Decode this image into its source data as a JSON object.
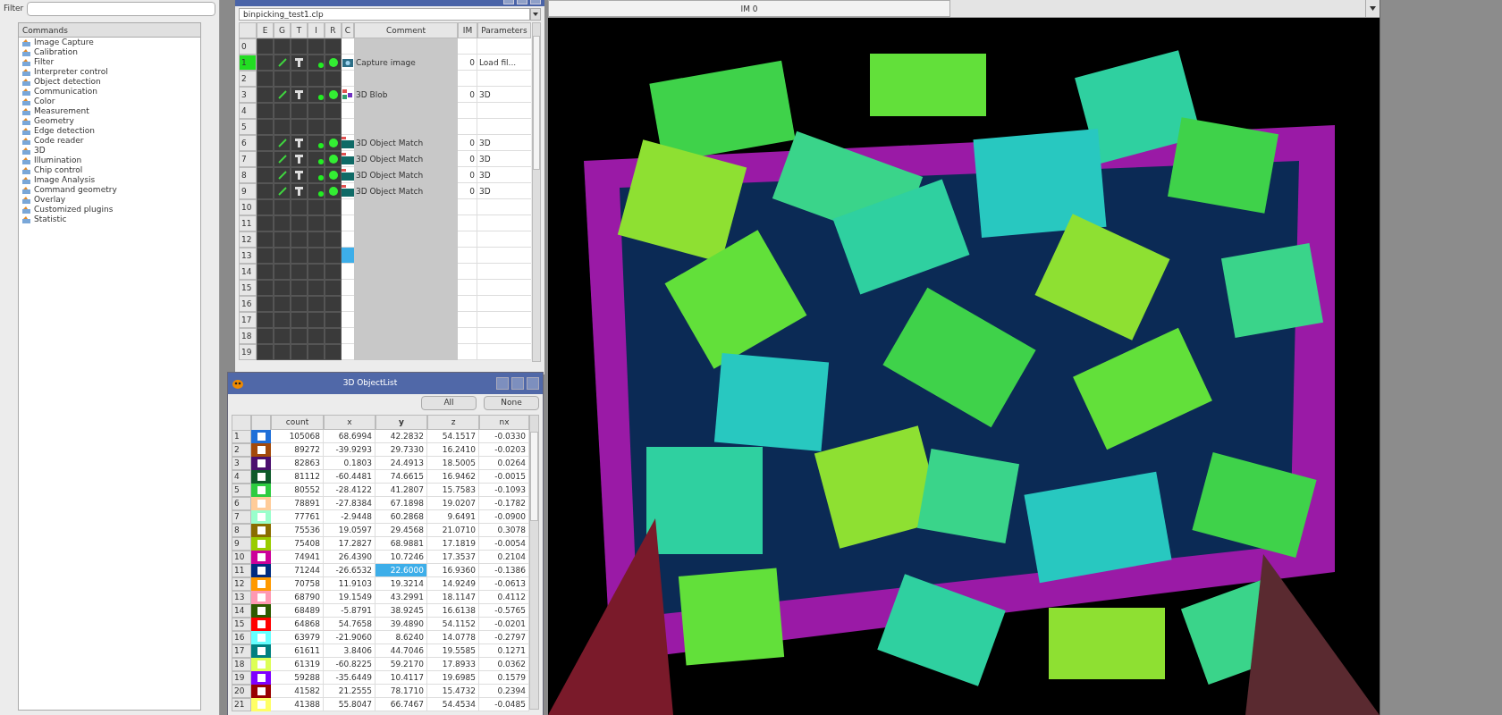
{
  "commands_panel": {
    "filter_label": "Filter",
    "header": "Commands",
    "items": [
      "Image Capture",
      "Calibration",
      "Filter",
      "Interpreter control",
      "Object detection",
      "Communication",
      "Color",
      "Measurement",
      "Geometry",
      "Edge detection",
      "Code reader",
      "3D",
      "Illumination",
      "Chip control",
      "Image Analysis",
      "Command geometry",
      "Overlay",
      "Customized plugins",
      "Statistic"
    ]
  },
  "program_window": {
    "file": "binpicking_test1.clp",
    "columns": [
      "E",
      "G",
      "T",
      "I",
      "R",
      "C",
      "Comment",
      "IM",
      "Parameters"
    ],
    "rows": [
      {
        "number": "0",
        "kind": "empty",
        "active": false,
        "selected": false
      },
      {
        "number": "1",
        "kind": "capture",
        "active": true,
        "selected": false,
        "comment": "Capture image",
        "im": "0",
        "parameters": "Load fil..."
      },
      {
        "number": "2",
        "kind": "empty",
        "active": false,
        "selected": false
      },
      {
        "number": "3",
        "kind": "blob",
        "active": false,
        "selected": false,
        "comment": "3D Blob",
        "im": "0",
        "parameters": "3D"
      },
      {
        "number": "4",
        "kind": "empty",
        "active": false,
        "selected": false
      },
      {
        "number": "5",
        "kind": "empty",
        "active": false,
        "selected": false
      },
      {
        "number": "6",
        "kind": "match",
        "active": false,
        "selected": false,
        "comment": "3D Object Match",
        "im": "0",
        "parameters": "3D"
      },
      {
        "number": "7",
        "kind": "match",
        "active": false,
        "selected": false,
        "comment": "3D Object Match",
        "im": "0",
        "parameters": "3D"
      },
      {
        "number": "8",
        "kind": "match",
        "active": false,
        "selected": false,
        "comment": "3D Object Match",
        "im": "0",
        "parameters": "3D"
      },
      {
        "number": "9",
        "kind": "match",
        "active": false,
        "selected": false,
        "comment": "3D Object Match",
        "im": "0",
        "parameters": "3D"
      },
      {
        "number": "10",
        "kind": "empty",
        "active": false,
        "selected": false
      },
      {
        "number": "11",
        "kind": "empty",
        "active": false,
        "selected": false
      },
      {
        "number": "12",
        "kind": "empty",
        "active": false,
        "selected": false
      },
      {
        "number": "13",
        "kind": "empty",
        "active": false,
        "selected": true
      },
      {
        "number": "14",
        "kind": "empty",
        "active": false,
        "selected": false
      },
      {
        "number": "15",
        "kind": "empty",
        "active": false,
        "selected": false
      },
      {
        "number": "16",
        "kind": "empty",
        "active": false,
        "selected": false
      },
      {
        "number": "17",
        "kind": "empty",
        "active": false,
        "selected": false
      },
      {
        "number": "18",
        "kind": "empty",
        "active": false,
        "selected": false
      },
      {
        "number": "19",
        "kind": "empty",
        "active": false,
        "selected": false
      }
    ]
  },
  "object_list": {
    "title": "3D ObjectList",
    "buttons": [
      "All",
      "None"
    ],
    "columns": [
      {
        "label": "count",
        "selected": false
      },
      {
        "label": "x",
        "selected": false
      },
      {
        "label": "y",
        "selected": true
      },
      {
        "label": "z",
        "selected": false
      },
      {
        "label": "nx",
        "selected": false
      }
    ],
    "rows": [
      {
        "number": "1",
        "color": "#1f6fd8",
        "selected": false,
        "values": [
          "105068",
          "68.6994",
          "42.2832",
          "54.1517",
          "-0.0330"
        ]
      },
      {
        "number": "2",
        "color": "#a34a0a",
        "selected": false,
        "values": [
          "89272",
          "-39.9293",
          "29.7330",
          "16.2410",
          "-0.0203"
        ]
      },
      {
        "number": "3",
        "color": "#4b0f6e",
        "selected": false,
        "values": [
          "82863",
          "0.1803",
          "24.4913",
          "18.5005",
          "0.0264"
        ]
      },
      {
        "number": "4",
        "color": "#0f5a2a",
        "selected": false,
        "values": [
          "81112",
          "-60.4481",
          "74.6615",
          "16.9462",
          "-0.0015"
        ]
      },
      {
        "number": "5",
        "color": "#2ecc40",
        "selected": false,
        "values": [
          "80552",
          "-28.4122",
          "41.2807",
          "15.7583",
          "-0.1093"
        ]
      },
      {
        "number": "6",
        "color": "#ffcc99",
        "selected": false,
        "values": [
          "78891",
          "-27.8384",
          "67.1898",
          "19.0207",
          "-0.1782"
        ]
      },
      {
        "number": "7",
        "color": "#99ffcc",
        "selected": false,
        "values": [
          "77761",
          "-2.9448",
          "60.2868",
          "9.6491",
          "-0.0900"
        ]
      },
      {
        "number": "8",
        "color": "#8a6d00",
        "selected": false,
        "values": [
          "75536",
          "19.0597",
          "29.4568",
          "21.0710",
          "0.3078"
        ]
      },
      {
        "number": "9",
        "color": "#99cc00",
        "selected": false,
        "values": [
          "75408",
          "17.2827",
          "68.9881",
          "17.1819",
          "-0.0054"
        ]
      },
      {
        "number": "10",
        "color": "#cc0099",
        "selected": false,
        "values": [
          "74941",
          "26.4390",
          "10.7246",
          "17.3537",
          "0.2104"
        ]
      },
      {
        "number": "11",
        "color": "#002b80",
        "selected": true,
        "values": [
          "71244",
          "-26.6532",
          "22.6000",
          "16.9360",
          "-0.1386"
        ]
      },
      {
        "number": "12",
        "color": "#ff9900",
        "selected": false,
        "values": [
          "70758",
          "11.9103",
          "19.3214",
          "14.9249",
          "-0.0613"
        ]
      },
      {
        "number": "13",
        "color": "#ff99b3",
        "selected": false,
        "values": [
          "68790",
          "19.1549",
          "43.2991",
          "18.1147",
          "0.4112"
        ]
      },
      {
        "number": "14",
        "color": "#2d5a00",
        "selected": false,
        "values": [
          "68489",
          "-5.8791",
          "38.9245",
          "16.6138",
          "-0.5765"
        ]
      },
      {
        "number": "15",
        "color": "#ff0000",
        "selected": false,
        "values": [
          "64868",
          "54.7658",
          "39.4890",
          "54.1152",
          "-0.0201"
        ]
      },
      {
        "number": "16",
        "color": "#66ffff",
        "selected": false,
        "values": [
          "63979",
          "-21.9060",
          "8.6240",
          "14.0778",
          "-0.2797"
        ]
      },
      {
        "number": "17",
        "color": "#008080",
        "selected": false,
        "values": [
          "61611",
          "3.8406",
          "44.7046",
          "19.5585",
          "0.1271"
        ]
      },
      {
        "number": "18",
        "color": "#ddff55",
        "selected": false,
        "values": [
          "61319",
          "-60.8225",
          "59.2170",
          "17.8933",
          "0.0362"
        ]
      },
      {
        "number": "19",
        "color": "#7f00ff",
        "selected": false,
        "values": [
          "59288",
          "-35.6449",
          "10.4117",
          "19.6985",
          "0.1579"
        ]
      },
      {
        "number": "20",
        "color": "#990000",
        "selected": false,
        "values": [
          "41582",
          "21.2555",
          "78.1710",
          "15.4732",
          "0.2394"
        ]
      },
      {
        "number": "21",
        "color": "#ffff66",
        "selected": false,
        "values": [
          "41388",
          "55.8047",
          "66.7467",
          "54.4534",
          "-0.0485"
        ]
      }
    ]
  },
  "image_window": {
    "tab": "IM 0"
  }
}
